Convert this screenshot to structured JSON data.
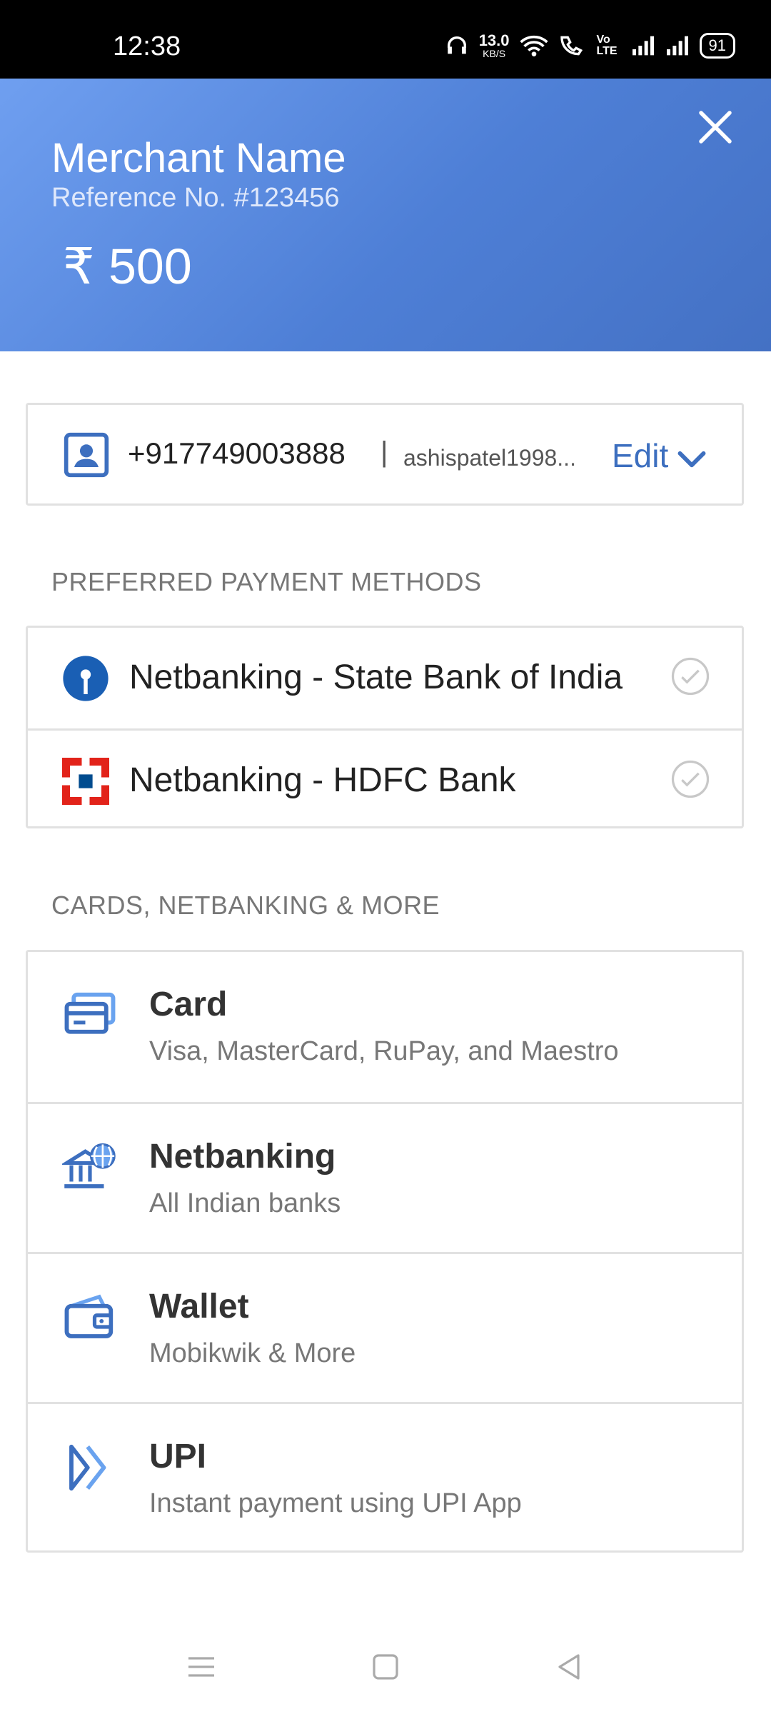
{
  "status_bar": {
    "time": "12:38",
    "speed": "13.0",
    "speed_unit": "KB/S",
    "network_label": "Vo LTE",
    "battery": "91"
  },
  "header": {
    "merchant_name": "Merchant Name",
    "reference": "Reference No. #123456",
    "amount": "₹ 500",
    "close_icon": "close-icon"
  },
  "contact": {
    "phone": "+917749003888",
    "separator": "|",
    "email": "ashispatel1998...",
    "edit_label": "Edit"
  },
  "preferred": {
    "title": "PREFERRED PAYMENT METHODS",
    "items": [
      {
        "label": "Netbanking - State Bank of India",
        "icon": "sbi-logo-icon"
      },
      {
        "label": "Netbanking - HDFC Bank",
        "icon": "hdfc-logo-icon"
      }
    ]
  },
  "more": {
    "title": "CARDS, NETBANKING & MORE",
    "items": [
      {
        "title": "Card",
        "subtitle": "Visa, MasterCard, RuPay, and Maestro",
        "icon": "card-icon"
      },
      {
        "title": "Netbanking",
        "subtitle": "All Indian banks",
        "icon": "bank-icon"
      },
      {
        "title": "Wallet",
        "subtitle": "Mobikwik & More",
        "icon": "wallet-icon"
      },
      {
        "title": "UPI",
        "subtitle": "Instant payment using UPI App",
        "icon": "upi-icon"
      }
    ]
  },
  "colors": {
    "header_start": "#6f9ff0",
    "header_end": "#4471c4",
    "accent": "#3d6fbf",
    "sbi_blue": "#1a5fb4",
    "hdfc_red": "#e2231a"
  }
}
